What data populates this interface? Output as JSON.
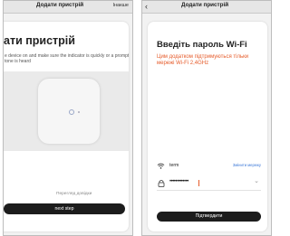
{
  "left_screen": {
    "title": "Додати пристрій",
    "action": "Інакше",
    "heading": "ати пристрій",
    "description": "e device on and make sure the indicator is quickly or a prompt tone is heard",
    "check_link": "Перегляд довідки",
    "next_button": "next step"
  },
  "right_screen": {
    "title": "Додати пристрій",
    "back_icon": "chevron-left-icon",
    "heading": "Введіть пароль Wi-Fi",
    "note": "Цим додатком підтримуються тільки мережі Wi-Fi 2,4GHz",
    "ssid": "term",
    "change_network": "Змінити мережу",
    "password_mask": "•••••••••••••",
    "confirm_button": "Підтвердити"
  },
  "colors": {
    "accent": "#e65b2a",
    "link": "#3b78d8",
    "button": "#1c1c1c"
  }
}
